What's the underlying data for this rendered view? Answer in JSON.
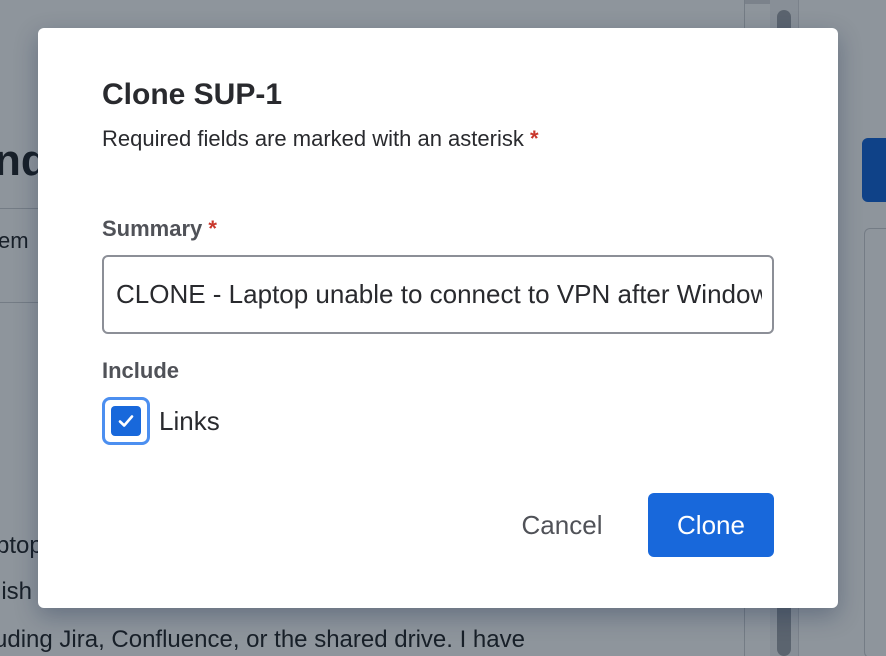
{
  "background": {
    "heading_fragment": "nde",
    "field_label_fragment": "em",
    "description_lines": [
      "ptop",
      "lish",
      "uding Jira, Confluence, or the shared drive. I have"
    ]
  },
  "dialog": {
    "title": "Clone SUP-1",
    "subtitle": "Required fields are marked with an asterisk",
    "required_marker": "*",
    "summary": {
      "label": "Summary",
      "value": "CLONE - Laptop unable to connect to VPN after Windows update"
    },
    "include": {
      "label": "Include",
      "options": [
        {
          "label": "Links",
          "checked": true
        }
      ]
    },
    "actions": {
      "cancel_label": "Cancel",
      "clone_label": "Clone"
    }
  },
  "colors": {
    "primary": "#1868db",
    "required": "#c9372c",
    "overlay": "rgba(5, 21, 36, 0.45)",
    "focus_ring": "#4c8ff0"
  },
  "icons": {
    "checkbox_check": "checkmark-icon"
  }
}
